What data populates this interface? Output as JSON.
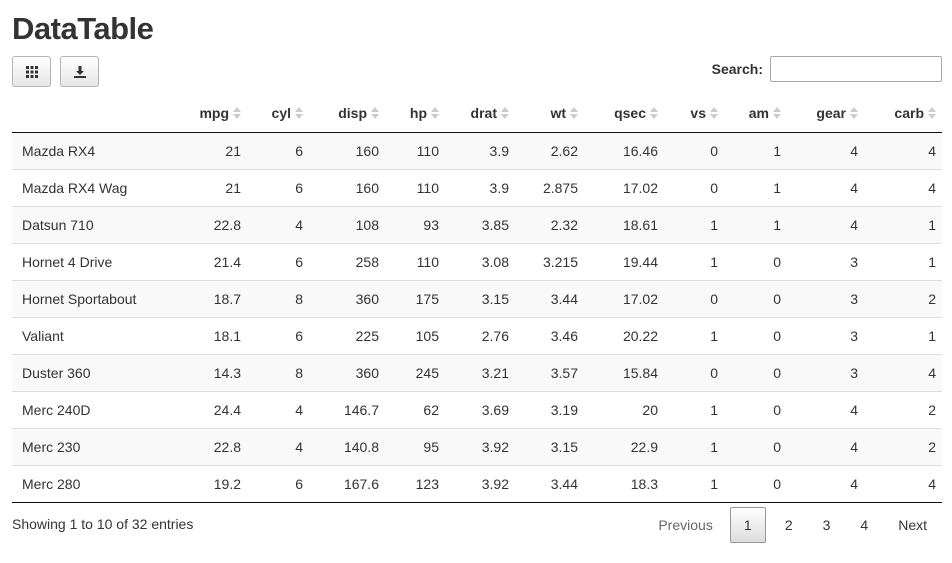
{
  "title": "DataTable",
  "toolbar": {
    "buttons": [
      {
        "icon": "grid-icon"
      },
      {
        "icon": "download-icon"
      }
    ]
  },
  "search": {
    "label": "Search:",
    "value": "",
    "placeholder": ""
  },
  "table": {
    "columns": [
      "",
      "mpg",
      "cyl",
      "disp",
      "hp",
      "drat",
      "wt",
      "qsec",
      "vs",
      "am",
      "gear",
      "carb"
    ],
    "rows": [
      [
        "Mazda RX4",
        "21",
        "6",
        "160",
        "110",
        "3.9",
        "2.62",
        "16.46",
        "0",
        "1",
        "4",
        "4"
      ],
      [
        "Mazda RX4 Wag",
        "21",
        "6",
        "160",
        "110",
        "3.9",
        "2.875",
        "17.02",
        "0",
        "1",
        "4",
        "4"
      ],
      [
        "Datsun 710",
        "22.8",
        "4",
        "108",
        "93",
        "3.85",
        "2.32",
        "18.61",
        "1",
        "1",
        "4",
        "1"
      ],
      [
        "Hornet 4 Drive",
        "21.4",
        "6",
        "258",
        "110",
        "3.08",
        "3.215",
        "19.44",
        "1",
        "0",
        "3",
        "1"
      ],
      [
        "Hornet Sportabout",
        "18.7",
        "8",
        "360",
        "175",
        "3.15",
        "3.44",
        "17.02",
        "0",
        "0",
        "3",
        "2"
      ],
      [
        "Valiant",
        "18.1",
        "6",
        "225",
        "105",
        "2.76",
        "3.46",
        "20.22",
        "1",
        "0",
        "3",
        "1"
      ],
      [
        "Duster 360",
        "14.3",
        "8",
        "360",
        "245",
        "3.21",
        "3.57",
        "15.84",
        "0",
        "0",
        "3",
        "4"
      ],
      [
        "Merc 240D",
        "24.4",
        "4",
        "146.7",
        "62",
        "3.69",
        "3.19",
        "20",
        "1",
        "0",
        "4",
        "2"
      ],
      [
        "Merc 230",
        "22.8",
        "4",
        "140.8",
        "95",
        "3.92",
        "3.15",
        "22.9",
        "1",
        "0",
        "4",
        "2"
      ],
      [
        "Merc 280",
        "19.2",
        "6",
        "167.6",
        "123",
        "3.92",
        "3.44",
        "18.3",
        "1",
        "0",
        "4",
        "4"
      ]
    ]
  },
  "info": "Showing 1 to 10 of 32 entries",
  "pagination": {
    "previous": "Previous",
    "pages": [
      "1",
      "2",
      "3",
      "4"
    ],
    "current": "1",
    "next": "Next"
  }
}
